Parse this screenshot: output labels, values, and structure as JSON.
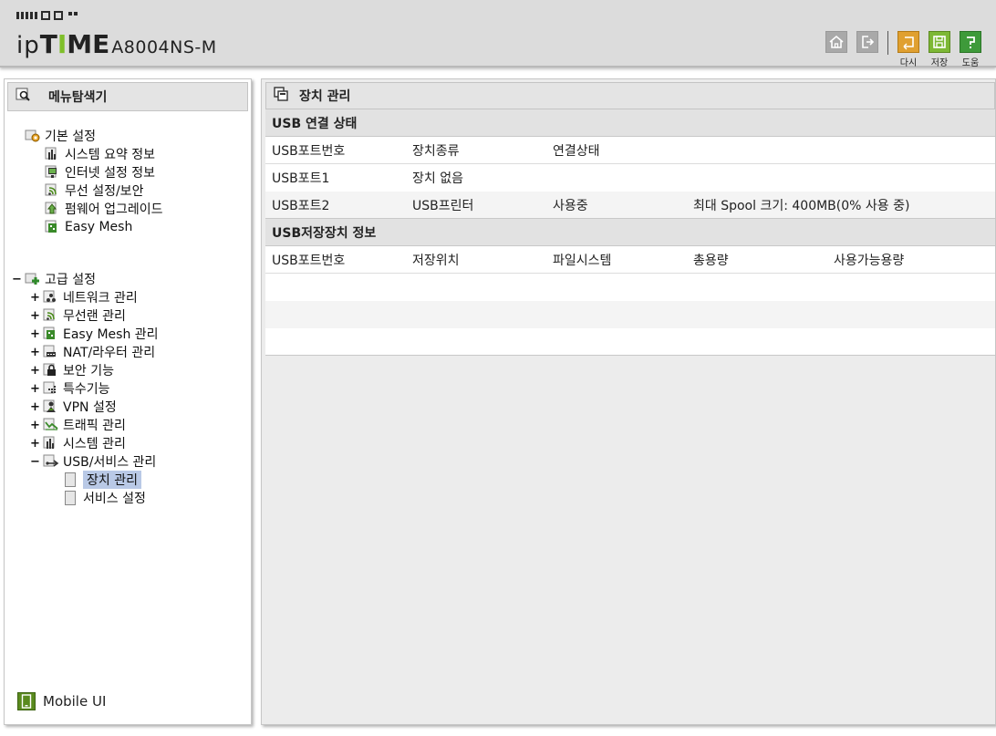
{
  "header": {
    "logo_ip": "ip",
    "logo_time_prefix": "T",
    "logo_time_i": "I",
    "logo_time_suffix": "ME",
    "model": "A8004NS-M",
    "buttons": [
      {
        "name": "home",
        "label": ""
      },
      {
        "name": "logout",
        "label": ""
      },
      {
        "name": "reload",
        "label": "다시"
      },
      {
        "name": "save",
        "label": "저장"
      },
      {
        "name": "help",
        "label": "도움"
      }
    ],
    "colors": {
      "reload": "#e0a030",
      "save": "#7db835",
      "help": "#3e9a3a",
      "gray_btn": "#a9a9a9"
    }
  },
  "sidebar": {
    "title": "메뉴탐색기",
    "basic": {
      "label": "기본 설정",
      "items": [
        "시스템 요약 정보",
        "인터넷 설정 정보",
        "무선 설정/보안",
        "펌웨어 업그레이드",
        "Easy Mesh"
      ]
    },
    "advanced": {
      "toggle": "−",
      "label": "고급 설정",
      "items": [
        {
          "toggle": "+",
          "label": "네트워크 관리",
          "icon": "network-icon"
        },
        {
          "toggle": "+",
          "label": "무선랜 관리",
          "icon": "wireless-icon"
        },
        {
          "toggle": "+",
          "label": "Easy Mesh 관리",
          "icon": "mesh-icon"
        },
        {
          "toggle": "+",
          "label": "NAT/라우터 관리",
          "icon": "router-icon"
        },
        {
          "toggle": "+",
          "label": "보안 기능",
          "icon": "lock-icon"
        },
        {
          "toggle": "+",
          "label": "특수기능",
          "icon": "special-icon"
        },
        {
          "toggle": "+",
          "label": "VPN 설정",
          "icon": "vpn-icon"
        },
        {
          "toggle": "+",
          "label": "트래픽 관리",
          "icon": "traffic-icon"
        },
        {
          "toggle": "+",
          "label": "시스템 관리",
          "icon": "system-icon"
        },
        {
          "toggle": "−",
          "label": "USB/서비스 관리",
          "icon": "usb-icon"
        }
      ],
      "usb_children": [
        "장치 관리",
        "서비스 설정"
      ]
    },
    "mobile_ui": "Mobile UI"
  },
  "main": {
    "title": "장치 관리",
    "usb_status": {
      "heading": "USB 연결 상태",
      "columns": [
        "USB포트번호",
        "장치종류",
        "연결상태"
      ],
      "rows": [
        [
          "USB포트1",
          "장치 없음",
          "",
          ""
        ],
        [
          "USB포트2",
          "USB프린터",
          "사용중",
          "최대 Spool 크기: 400MB(0% 사용 중)"
        ]
      ]
    },
    "storage": {
      "heading": "USB저장장치 정보",
      "columns": [
        "USB포트번호",
        "저장위치",
        "파일시스템",
        "총용량",
        "사용가능용량"
      ]
    }
  }
}
